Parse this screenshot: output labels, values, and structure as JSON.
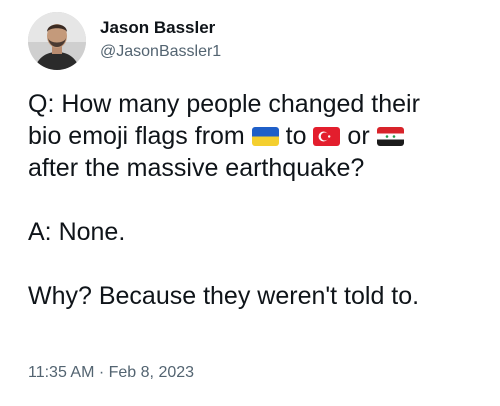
{
  "author": {
    "display_name": "Jason Bassler",
    "handle": "@JasonBassler1"
  },
  "tweet": {
    "q_line1": "Q: How many people changed their",
    "q_line2_a": "bio emoji flags from",
    "q_line2_b": "to",
    "q_line2_c": "or",
    "q_line3": "after the massive earthquake?",
    "answer": "A: None.",
    "followup": "Why? Because they weren't told to.",
    "flags": [
      "ukraine-flag-icon",
      "turkey-flag-icon",
      "syria-flag-icon"
    ]
  },
  "meta": {
    "timestamp": "11:35 AM · Feb 8, 2023"
  },
  "colors": {
    "text": "#0f1419",
    "secondary": "#536471"
  }
}
